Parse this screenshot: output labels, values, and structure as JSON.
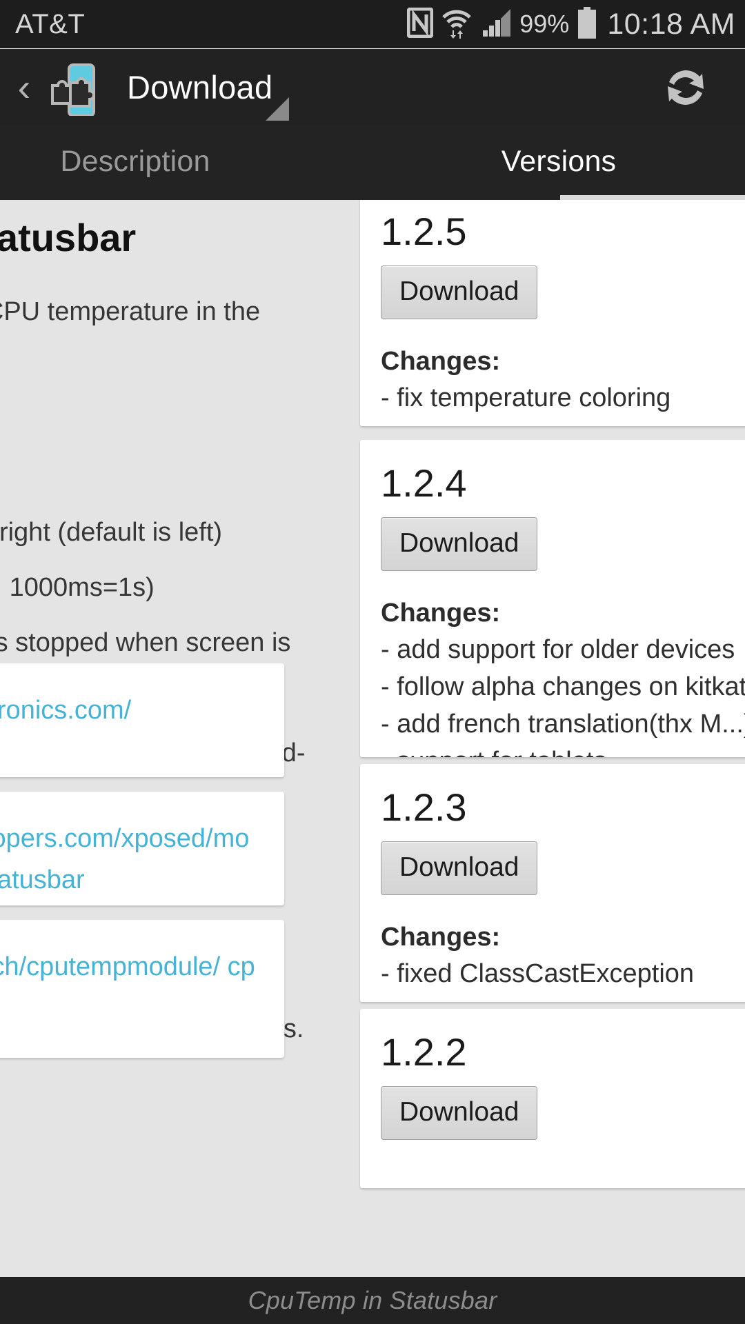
{
  "statusbar": {
    "carrier": "AT&T",
    "battery_percent": "99%",
    "clock": "10:18 AM",
    "icons": [
      "nfc-icon",
      "wifi-icon",
      "cellular-signal-icon",
      "battery-icon"
    ]
  },
  "actionbar": {
    "back_label": "‹",
    "app_icon": "xposed-module-puzzle-icon",
    "title": "Download",
    "refresh_label": "refresh-icon",
    "accent_color": "#5ecbe0"
  },
  "tabs": [
    {
      "label": "Description",
      "selected": false
    },
    {
      "label": "Versions",
      "selected": true
    }
  ],
  "description_pane": {
    "title": "CpuTemp in Statusbar",
    "body": "A module to show the CPU temperature in the statusbar.\n\nFeatures:\n- position: left / center / right (default is left)\n- refresh interval (in ms, 1000ms=1s)\n- save battery: refresh is stopped when screen is turned off\n- coloring: static color, temperature-based or load-based\n- units: Celsius, Kelvin and Fahrenheit\n\nIf the module does not work on your device just create a new thread or write a reply in the forums.",
    "links": [
      {
        "text": "http://www.vitsch-electronics.com/"
      },
      {
        "text": "http://forum.xda-developers.com/xposed/modules/mod-cputemp-statusbar"
      },
      {
        "text": "https://github.com/vitsch/cputempmodule/\ncputempstatusbar"
      }
    ]
  },
  "versions_pane": {
    "download_label": "Download",
    "changes_label": "Changes:",
    "items": [
      {
        "version": "1.2.5",
        "changes": [
          "- fix temperature coloring"
        ]
      },
      {
        "version": "1.2.4",
        "changes": [
          "- add support for older devices",
          "- follow alpha changes on kitkat",
          "- add french translation(thx M...)",
          "- support for tablets"
        ]
      },
      {
        "version": "1.2.3",
        "changes": [
          "- fixed ClassCastException"
        ]
      },
      {
        "version": "1.2.2",
        "changes": []
      }
    ]
  },
  "bottombar": {
    "title": "CpuTemp in Statusbar"
  }
}
